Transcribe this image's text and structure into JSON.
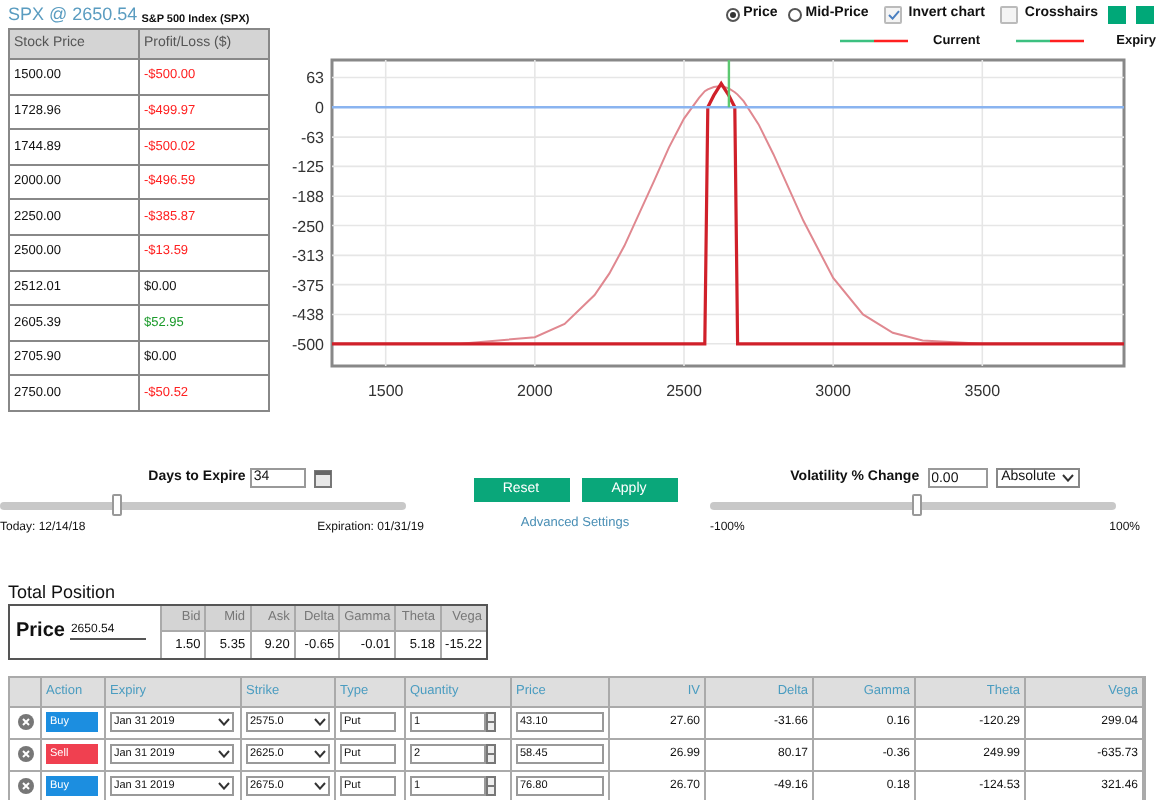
{
  "header": {
    "symbol": "SPX @ 2650.54",
    "name": "S&P 500 Index (SPX)"
  },
  "pl_table": {
    "columns": [
      "Stock Price",
      "Profit/Loss ($)"
    ],
    "rows": [
      {
        "price": "1500.00",
        "pl": "-$500.00",
        "color": "#ff2020"
      },
      {
        "price": "1728.96",
        "pl": "-$499.97",
        "color": "#ff2020"
      },
      {
        "price": "1744.89",
        "pl": "-$500.02",
        "color": "#ff2020"
      },
      {
        "price": "2000.00",
        "pl": "-$496.59",
        "color": "#ff2020"
      },
      {
        "price": "2250.00",
        "pl": "-$385.87",
        "color": "#ff2020"
      },
      {
        "price": "2500.00",
        "pl": "-$13.59",
        "color": "#ff2020"
      },
      {
        "price": "2512.01",
        "pl": "$0.00",
        "color": "#111111"
      },
      {
        "price": "2605.39",
        "pl": "$52.95",
        "color": "#1a9a2a"
      },
      {
        "price": "2705.90",
        "pl": "$0.00",
        "color": "#111111"
      },
      {
        "price": "2750.00",
        "pl": "-$50.52",
        "color": "#ff2020"
      }
    ]
  },
  "chart_options": {
    "price_modes": [
      {
        "label": "Price",
        "selected": true
      },
      {
        "label": "Mid-Price",
        "selected": false
      }
    ],
    "toggles": [
      {
        "label": "Invert chart",
        "checked": true
      },
      {
        "label": "Crosshairs",
        "checked": false
      }
    ],
    "swatches": [
      {
        "color": "#00a878"
      },
      {
        "color": "#00a878"
      }
    ]
  },
  "chart": {
    "chart_data": {
      "type": "line",
      "grid": true,
      "xlim": [
        1320,
        3975
      ],
      "ylim": [
        -547,
        100
      ],
      "xticks": [
        1500,
        2000,
        2500,
        3000,
        3500
      ],
      "yticks": [
        63,
        0,
        -63,
        -125,
        -188,
        -250,
        -313,
        -375,
        -438,
        -500
      ],
      "x": [
        1320,
        1500,
        1750,
        2000,
        2100,
        2200,
        2250,
        2300,
        2400,
        2450,
        2500,
        2550,
        2570,
        2580,
        2600,
        2625,
        2650,
        2670,
        2680,
        2700,
        2750,
        2800,
        2900,
        3000,
        3100,
        3200,
        3300,
        3500,
        3750,
        3975
      ],
      "series": [
        {
          "name": "Current",
          "color": "#e08890",
          "values": [
            -500,
            -500,
            -500,
            -486,
            -458,
            -397,
            -351,
            -293,
            -155,
            -85,
            -24,
            20,
            34,
            38,
            43,
            45,
            40,
            32,
            27,
            13,
            -36,
            -99,
            -240,
            -361,
            -438,
            -477,
            -493,
            -500,
            -500,
            -500
          ]
        },
        {
          "name": "Expiry",
          "color": "#d0202a",
          "values": [
            -500,
            -500,
            -500,
            -500,
            -500,
            -500,
            -500,
            -500,
            -500,
            -500,
            -500,
            -500,
            -500,
            0,
            25,
            50,
            25,
            0,
            -500,
            -500,
            -500,
            -500,
            -500,
            -500,
            -500,
            -500,
            -500,
            -500,
            -500,
            -500
          ]
        }
      ],
      "ref_lines": [
        {
          "axis": "y",
          "value": 0,
          "color": "#8ab4f0"
        },
        {
          "axis": "x",
          "value": 2650.54,
          "color": "#5cc870"
        }
      ]
    }
  },
  "days": {
    "label": "Days to Expire",
    "value": "34",
    "level": 0.29,
    "start": "Today: 12/14/18",
    "end": "Expiration: 01/31/19"
  },
  "buttons": [
    "Reset",
    "Apply"
  ],
  "advanced_link": "Advanced Settings",
  "volatility": {
    "label": "Volatility % Change",
    "value": "0.00",
    "mode": "Absolute",
    "level": 0.51,
    "min": "-100%",
    "max": "100%"
  },
  "total_position": {
    "title": "Total Position",
    "price_label": "Price",
    "price_value": "2650.54",
    "columns": [
      "Bid",
      "Mid",
      "Ask",
      "Delta",
      "Gamma",
      "Theta",
      "Vega"
    ],
    "values": [
      "1.50",
      "5.35",
      "9.20",
      "-0.65",
      "-0.01",
      "5.18",
      "-15.22"
    ]
  },
  "legs": {
    "columns": [
      "Action",
      "Expiry",
      "Strike",
      "Type",
      "Quantity",
      "Price",
      "IV",
      "Delta",
      "Gamma",
      "Theta",
      "Vega"
    ],
    "rows": [
      {
        "kind": "buy",
        "action": "Buy",
        "expiry": "Jan 31 2019",
        "strike": "2575.0",
        "type": "Put",
        "quantity": "1",
        "price": "43.10",
        "iv": "27.60",
        "delta": "-31.66",
        "gamma": "0.16",
        "theta": "-120.29",
        "vega": "299.04"
      },
      {
        "kind": "sell",
        "action": "Sell",
        "expiry": "Jan 31 2019",
        "strike": "2625.0",
        "type": "Put",
        "quantity": "2",
        "price": "58.45",
        "iv": "26.99",
        "delta": "80.17",
        "gamma": "-0.36",
        "theta": "249.99",
        "vega": "-635.73"
      },
      {
        "kind": "buy",
        "action": "Buy",
        "expiry": "Jan 31 2019",
        "strike": "2675.0",
        "type": "Put",
        "quantity": "1",
        "price": "76.80",
        "iv": "26.70",
        "delta": "-49.16",
        "gamma": "0.18",
        "theta": "-124.53",
        "vega": "321.46"
      }
    ]
  }
}
